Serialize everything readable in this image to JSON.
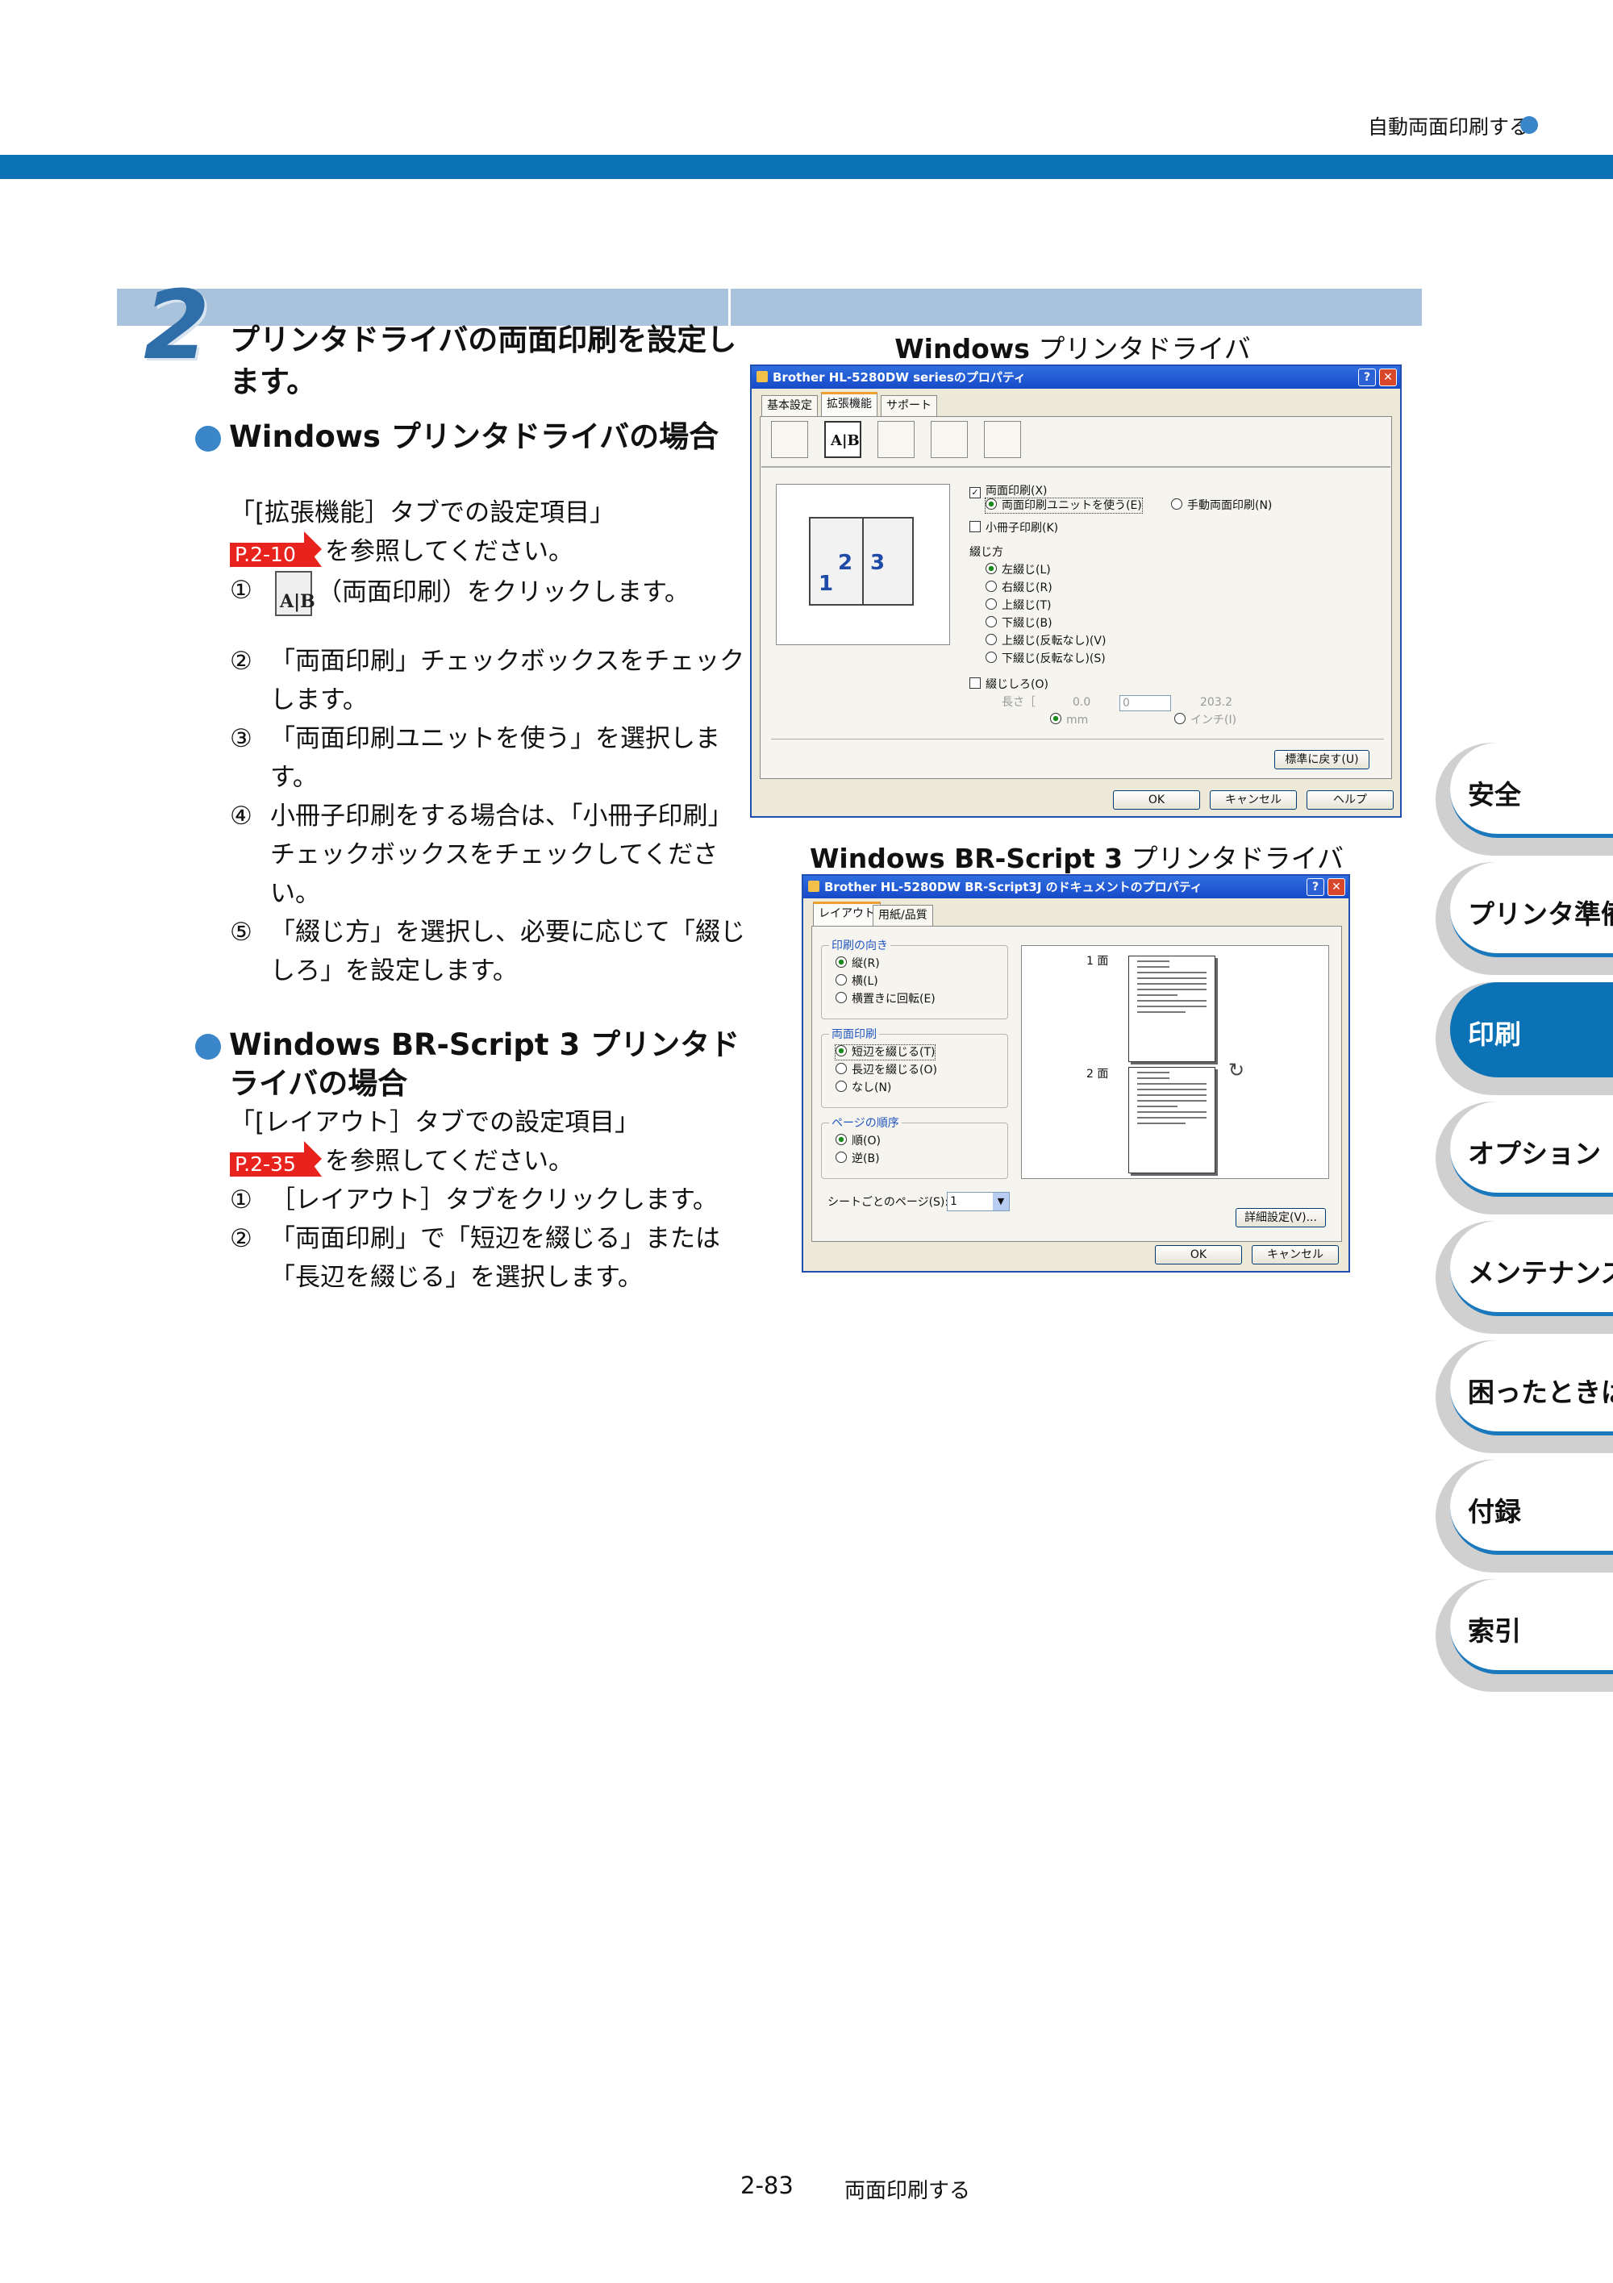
{
  "header": {
    "title": "自動両面印刷する"
  },
  "step": {
    "number": "2",
    "title": "プリンタドライバの両面印刷を設定します。"
  },
  "section_windows": {
    "heading": "Windows プリンタドライバの場合",
    "intro": "「[拡張機能］タブでの設定項目」",
    "ref": "P.2-10",
    "ref_suffix": "を参照してください。",
    "items": [
      {
        "num": "①",
        "text": "（両面印刷）をクリックします。"
      },
      {
        "num": "②",
        "text": "「両面印刷」チェックボックスをチェックします。"
      },
      {
        "num": "③",
        "text": "「両面印刷ユニットを使う」を選択します。"
      },
      {
        "num": "④",
        "text": "小冊子印刷をする場合は、「小冊子印刷」チェックボックスをチェックしてください。"
      },
      {
        "num": "⑤",
        "text": "「綴じ方」を選択し、必要に応じて「綴じしろ」を設定します。"
      }
    ]
  },
  "section_brscript": {
    "heading": "Windows BR-Script 3 プリンタドライバの場合",
    "intro": "「[レイアウト］タブでの設定項目」",
    "ref": "P.2-35",
    "ref_suffix": "を参照してください。",
    "items": [
      {
        "num": "①",
        "text": "［レイアウト］タブをクリックします。"
      },
      {
        "num": "②",
        "text": "「両面印刷」で「短辺を綴じる」または「長辺を綴じる」を選択します。"
      }
    ]
  },
  "screenshot1": {
    "caption_bold": "Windows",
    "caption_rest": " プリンタドライバ",
    "window_title": "Brother HL-5280DW seriesのプロパティ",
    "tabs": [
      "基本設定",
      "拡張機能",
      "サポート"
    ],
    "preview_numbers": [
      "2",
      "3",
      "1"
    ],
    "duplex": "両面印刷(X)",
    "use_unit": "両面印刷ユニットを使う(E)",
    "manual": "手動両面印刷(N)",
    "booklet": "小冊子印刷(K)",
    "binding_label": "綴じ方",
    "binding_options": [
      "左綴じ(L)",
      "右綴じ(R)",
      "上綴じ(T)",
      "下綴じ(B)",
      "上綴じ(反転なし)(V)",
      "下綴じ(反転なし)(S)"
    ],
    "margin": "綴じしろ(O)",
    "length_label": "長さ［",
    "length_min": "0.0",
    "length_value": "0",
    "length_max": "203.2",
    "unit_mm": "mm",
    "unit_inch": "インチ(I)",
    "defaults_button": "標準に戻す(U)",
    "ok": "OK",
    "cancel": "キャンセル",
    "help": "ヘルプ"
  },
  "screenshot2": {
    "caption_bold": "Windows BR-Script 3",
    "caption_rest": " プリンタドライバ",
    "window_title": "Brother HL-5280DW BR-Script3J のドキュメントのプロパティ",
    "tabs": [
      "レイアウト",
      "用紙/品質"
    ],
    "orientation_label": "印刷の向き",
    "orientation_options": [
      "縦(R)",
      "横(L)",
      "横置きに回転(E)"
    ],
    "duplex_label": "両面印刷",
    "duplex_options": [
      "短辺を綴じる(T)",
      "長辺を綴じる(O)",
      "なし(N)"
    ],
    "order_label": "ページの順序",
    "order_options": [
      "順(O)",
      "逆(B)"
    ],
    "pages_per_sheet_label": "シートごとのページ(S):",
    "pages_per_sheet_value": "1",
    "page1_label": "1 面",
    "page2_label": "2 面",
    "advanced_button": "詳細設定(V)...",
    "ok": "OK",
    "cancel": "キャンセル"
  },
  "side_tabs": [
    "安全",
    "プリンタ準備",
    "印刷",
    "オプション",
    "メンテナンス",
    "困ったときは",
    "付録",
    "索引"
  ],
  "side_tab_active": "印刷",
  "footer": {
    "page": "2-83",
    "title": "両面印刷する"
  },
  "colors": {
    "accent": "#0b72b5",
    "band": "#a9c3dd",
    "ref": "#e8231e"
  }
}
